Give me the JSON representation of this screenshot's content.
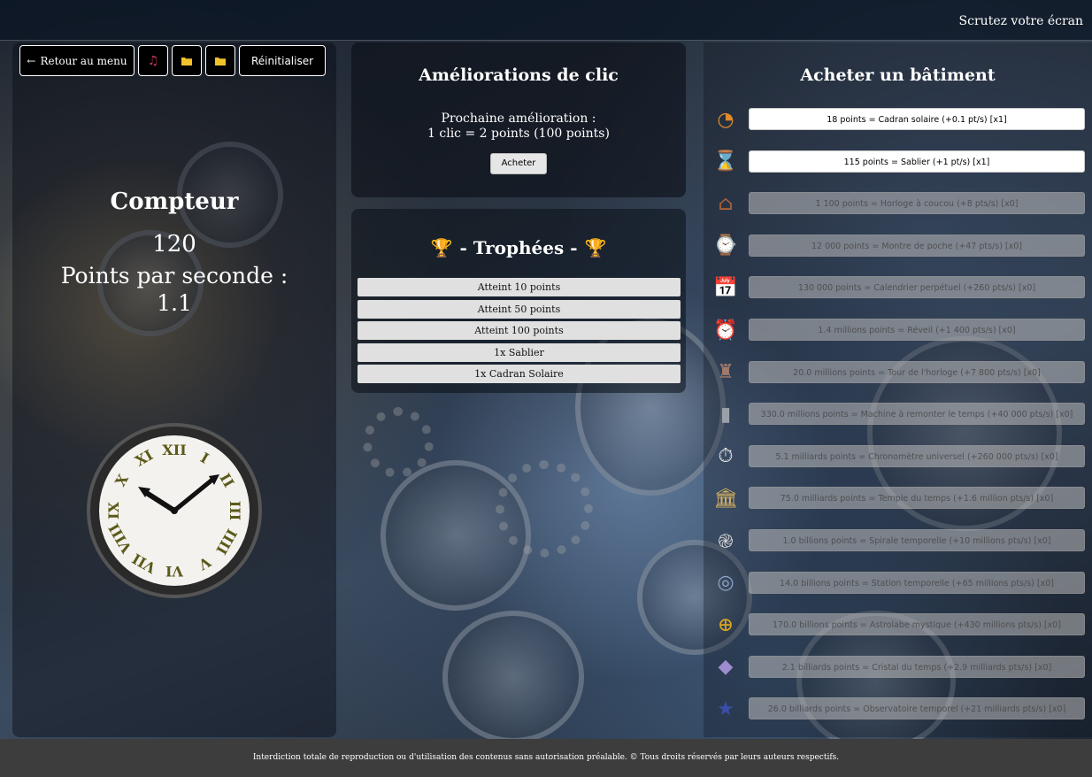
{
  "top_bar": {
    "hint": "Scrutez votre écran"
  },
  "toolbar": {
    "back_label": "Retour au menu",
    "music_icon": "music-note-icon",
    "folder_icon": "folder-icon",
    "reset_label": "Réinitialiser"
  },
  "counter": {
    "title": "Compteur",
    "value": "120",
    "pps_label": "Points par seconde :",
    "pps_value": "1.1"
  },
  "clock": {
    "numerals": [
      "XII",
      "I",
      "II",
      "III",
      "IIII",
      "V",
      "VI",
      "VII",
      "VIII",
      "IX",
      "X",
      "XI"
    ]
  },
  "click_upgrades": {
    "title": "Améliorations de clic",
    "next_label": "Prochaine amélioration :",
    "next_detail": "1 clic = 2 points (100 points)",
    "buy_label": "Acheter"
  },
  "trophies": {
    "title": "- Trophées -",
    "items": [
      "Atteint 10 points",
      "Atteint 50 points",
      "Atteint 100 points",
      "1x Sablier",
      "1x Cadran Solaire"
    ]
  },
  "buildings": {
    "title": "Acheter un bâtiment",
    "items": [
      {
        "label": "18 points = Cadran solaire (+0.1 pt/s) [x1]",
        "icon": "sundial-icon",
        "enabled": true
      },
      {
        "label": "115 points = Sablier (+1 pt/s) [x1]",
        "icon": "hourglass-icon",
        "enabled": true
      },
      {
        "label": "1 100 points = Horloge à coucou (+8 pts/s) [x0]",
        "icon": "cuckoo-clock-icon",
        "enabled": false
      },
      {
        "label": "12 000 points = Montre de poche (+47 pts/s) [x0]",
        "icon": "pocket-watch-icon",
        "enabled": false
      },
      {
        "label": "130 000 points = Calendrier perpétuel (+260 pts/s) [x0]",
        "icon": "calendar-icon",
        "enabled": false
      },
      {
        "label": "1.4 millions points = Réveil (+1 400 pts/s) [x0]",
        "icon": "alarm-clock-icon",
        "enabled": false
      },
      {
        "label": "20.0 millions points = Tour de l'horloge (+7 800 pts/s) [x0]",
        "icon": "clock-tower-icon",
        "enabled": false
      },
      {
        "label": "330.0 millions points = Machine à remonter le temps (+40 000 pts/s) [x0]",
        "icon": "time-machine-icon",
        "enabled": false
      },
      {
        "label": "5.1 milliards points = Chronomètre universel (+260 000 pts/s) [x0]",
        "icon": "stopwatch-icon",
        "enabled": false
      },
      {
        "label": "75.0 milliards points = Temple du temps (+1.6 million pts/s) [x0]",
        "icon": "temple-icon",
        "enabled": false
      },
      {
        "label": "1.0 billions points = Spirale temporelle (+10 millions pts/s) [x0]",
        "icon": "spiral-icon",
        "enabled": false
      },
      {
        "label": "14.0 billions points = Station temporelle (+65 millions pts/s) [x0]",
        "icon": "space-station-icon",
        "enabled": false
      },
      {
        "label": "170.0 billions points = Astrolabe mystique (+430 millions pts/s) [x0]",
        "icon": "astrolabe-icon",
        "enabled": false
      },
      {
        "label": "2.1 billiards points = Cristal du temps (+2.9 milliards pts/s) [x0]",
        "icon": "crystal-icon",
        "enabled": false
      },
      {
        "label": "26.0 billiards points = Observatoire temporel (+21 milliards pts/s) [x0]",
        "icon": "observatory-icon",
        "enabled": false
      }
    ]
  },
  "colors": {
    "trophy_gold": "#e0a81e",
    "toolbar_icon_yellow": "#f2c22b",
    "music_icon_red": "#c23a5a",
    "footer_bg": "#3d3d3d"
  },
  "footer": {
    "text": "Interdiction totale de reproduction ou d'utilisation des contenus sans autorisation préalable. © Tous droits réservés par leurs auteurs respectifs."
  }
}
